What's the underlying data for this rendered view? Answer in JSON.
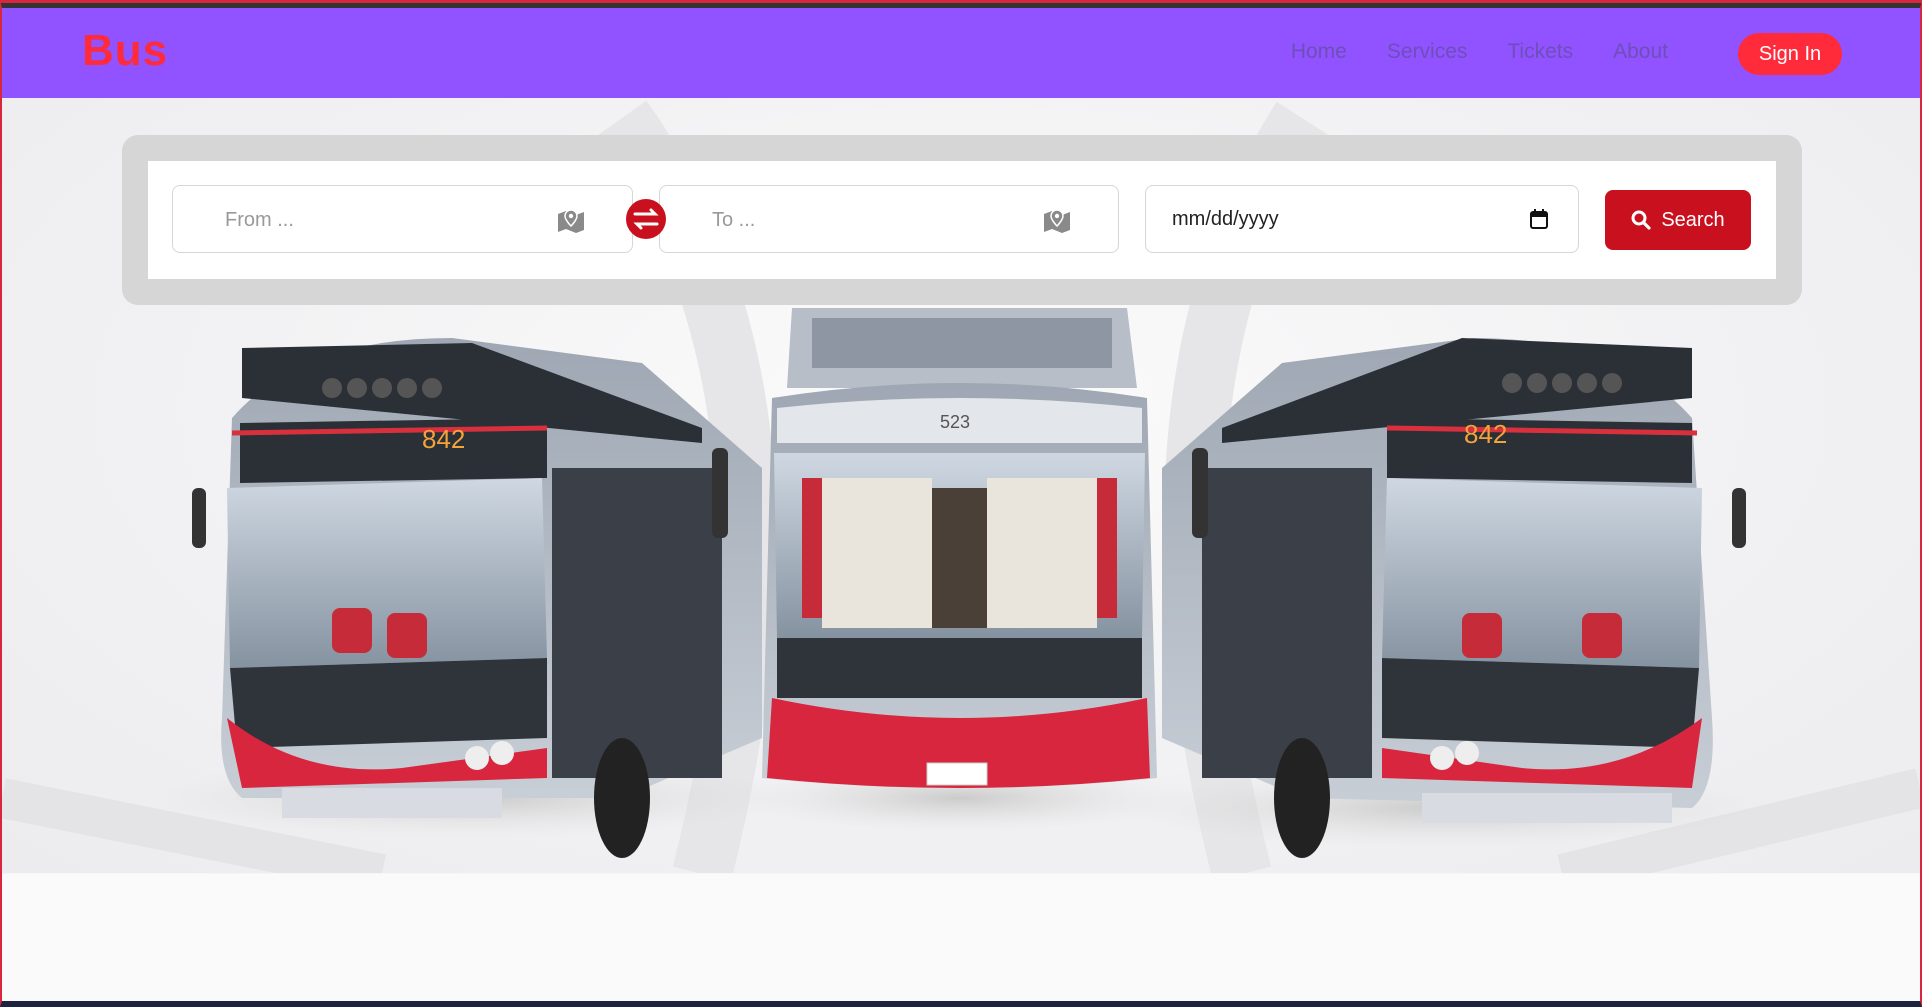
{
  "navbar": {
    "logo": "Bus",
    "links": [
      "Home",
      "Services",
      "Tickets",
      "About"
    ],
    "signin_label": "Sign In",
    "background": "#9152ff",
    "accent": "#ff2a3a"
  },
  "search": {
    "from_placeholder": "From ...",
    "to_placeholder": "To ...",
    "date_placeholder": "mm/dd/yyyy",
    "search_label": "Search",
    "button_color": "#c8101e"
  },
  "hero": {
    "left_bus_number": "842",
    "center_bus_number": "523",
    "right_bus_number": "842"
  }
}
